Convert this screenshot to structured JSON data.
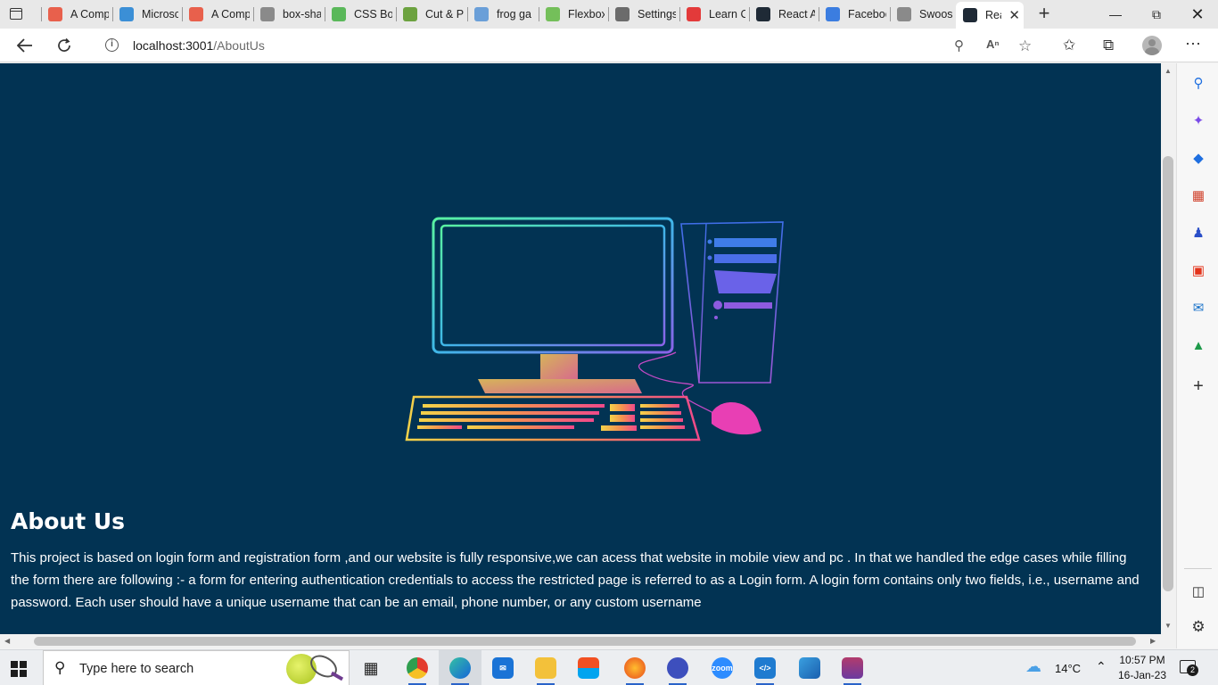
{
  "browser": {
    "tabs": [
      {
        "label": "A Comp",
        "icon": "asterisk-icon",
        "color": "#e8604c"
      },
      {
        "label": "Microsc",
        "icon": "edge-swirl-icon",
        "color": "#3b8fd6"
      },
      {
        "label": "A Comp",
        "icon": "asterisk-icon",
        "color": "#e8604c"
      },
      {
        "label": "box-sha",
        "icon": "m-logo-icon",
        "color": "#8a8a8a"
      },
      {
        "label": "CSS Box",
        "icon": "w3-logo-icon",
        "color": "#5ab85a"
      },
      {
        "label": "Cut & P",
        "icon": "k-logo-icon",
        "color": "#6ca23f"
      },
      {
        "label": "frog ga",
        "icon": "search-icon",
        "color": "#6a9fd8"
      },
      {
        "label": "Flexbox",
        "icon": "frog-icon",
        "color": "#74bf5a"
      },
      {
        "label": "Settings",
        "icon": "gear-icon",
        "color": "#6b6b6b"
      },
      {
        "label": "Learn C",
        "icon": "youtube-icon",
        "color": "#e33a3a"
      },
      {
        "label": "React A",
        "icon": "react-icon",
        "color": "#1f2a36"
      },
      {
        "label": "Faceboo",
        "icon": "facebook-icon",
        "color": "#3b7de0"
      },
      {
        "label": "Swoosh",
        "icon": "page-icon",
        "color": "#8a8a8a"
      },
      {
        "label": "Rea",
        "icon": "react-icon",
        "color": "#1f2a36",
        "active": true
      }
    ],
    "address": {
      "host": "localhost:3001",
      "path": "/AboutUs"
    }
  },
  "page": {
    "title": "About Us",
    "body": "This project is based on login form and registration form ,and our website is fully responsive,we can acess that website in mobile view and pc . In that we handled the edge cases while filling the form there are following :- a form for entering authentication credentials to access the restricted page is referred to as a Login form. A login form contains only two fields, i.e., username and password. Each user should have a unique username that can be an email, phone number, or any custom username",
    "background": "#023353"
  },
  "taskbar": {
    "search_placeholder": "Type here to search",
    "weather": "14°C",
    "time": "10:57 PM",
    "date": "16-Jan-23",
    "notifications": "2"
  }
}
